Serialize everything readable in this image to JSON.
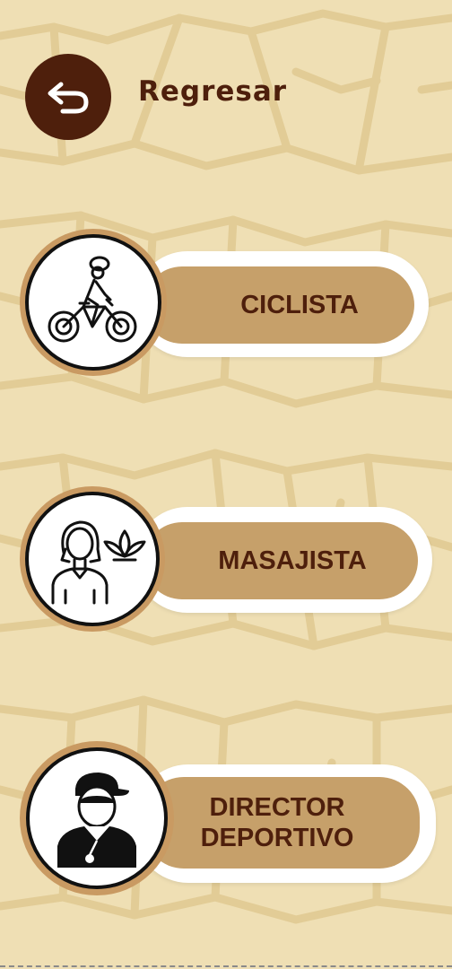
{
  "header": {
    "back_label": "Regresar",
    "back_icon": "undo-arrow-icon"
  },
  "roles": [
    {
      "label": "CICLISTA",
      "icon": "cyclist-icon"
    },
    {
      "label": "MASAJISTA",
      "icon": "masseuse-icon"
    },
    {
      "label_line1": "DIRECTOR",
      "label_line2": "DEPORTIVO",
      "icon": "sports-director-icon"
    }
  ],
  "colors": {
    "background": "#efdfb4",
    "dark_brown": "#4e1f0c",
    "pill_tan": "#c6a06a",
    "ring_tan": "#c99a62"
  }
}
